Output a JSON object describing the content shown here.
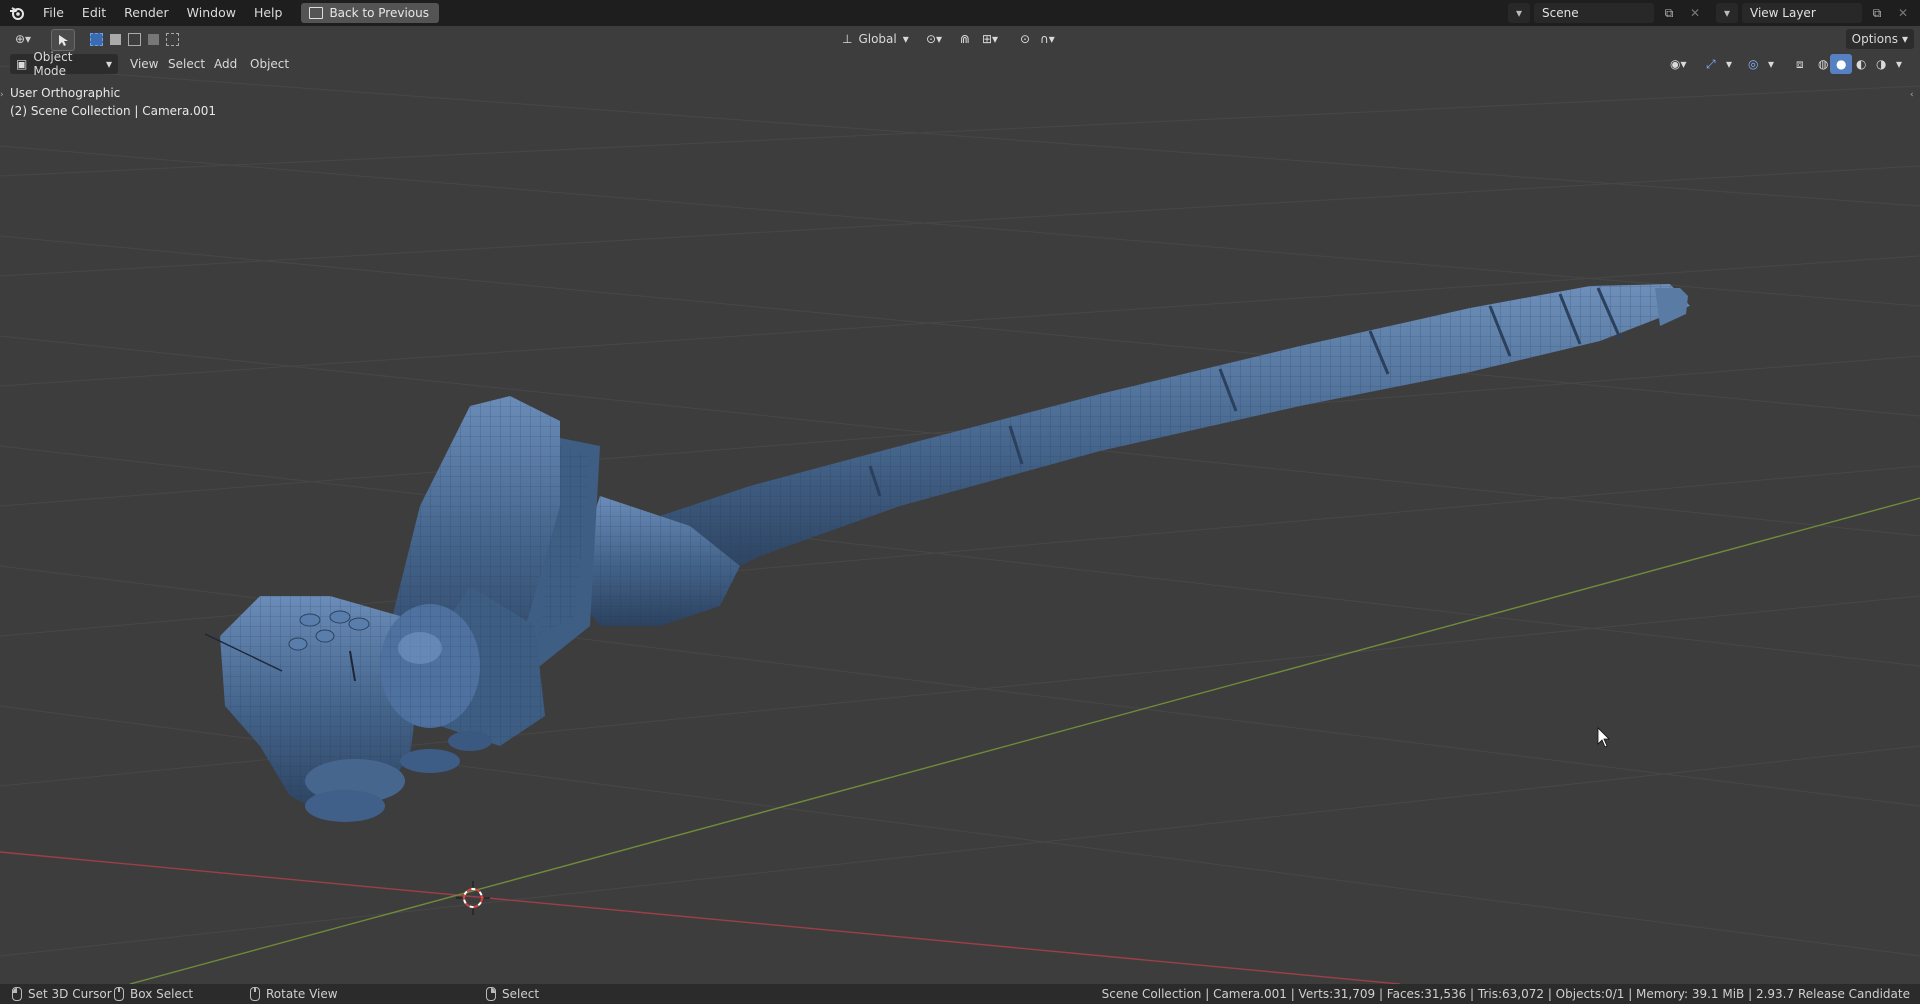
{
  "menu": {
    "items": [
      "File",
      "Edit",
      "Render",
      "Window",
      "Help"
    ],
    "back_button": "Back to Previous"
  },
  "top_right": {
    "scene_value": "Scene",
    "view_layer_value": "View Layer"
  },
  "viewport_header": {
    "mode": "Object Mode",
    "menus": [
      "View",
      "Select",
      "Add",
      "Object"
    ],
    "transform_orientation": "Global",
    "options_label": "Options"
  },
  "overlay": {
    "view_name": "User Orthographic",
    "collection_info": "(2) Scene Collection | Camera.001"
  },
  "statusbar": {
    "set_cursor": "Set 3D Cursor",
    "box_select": "Box Select",
    "rotate_view": "Rotate View",
    "select": "Select",
    "stats": "Scene Collection | Camera.001 | Verts:31,709 | Faces:31,536 | Tris:63,072 | Objects:0/1 | Memory: 39.1 MiB | 2.93.7 Release Candidate"
  },
  "colors": {
    "viewport_bg": "#3d3d3d",
    "mesh": "#4a6a90",
    "x_axis": "#9c3f48",
    "y_axis": "#6e8c3a",
    "grid": "#474747"
  }
}
